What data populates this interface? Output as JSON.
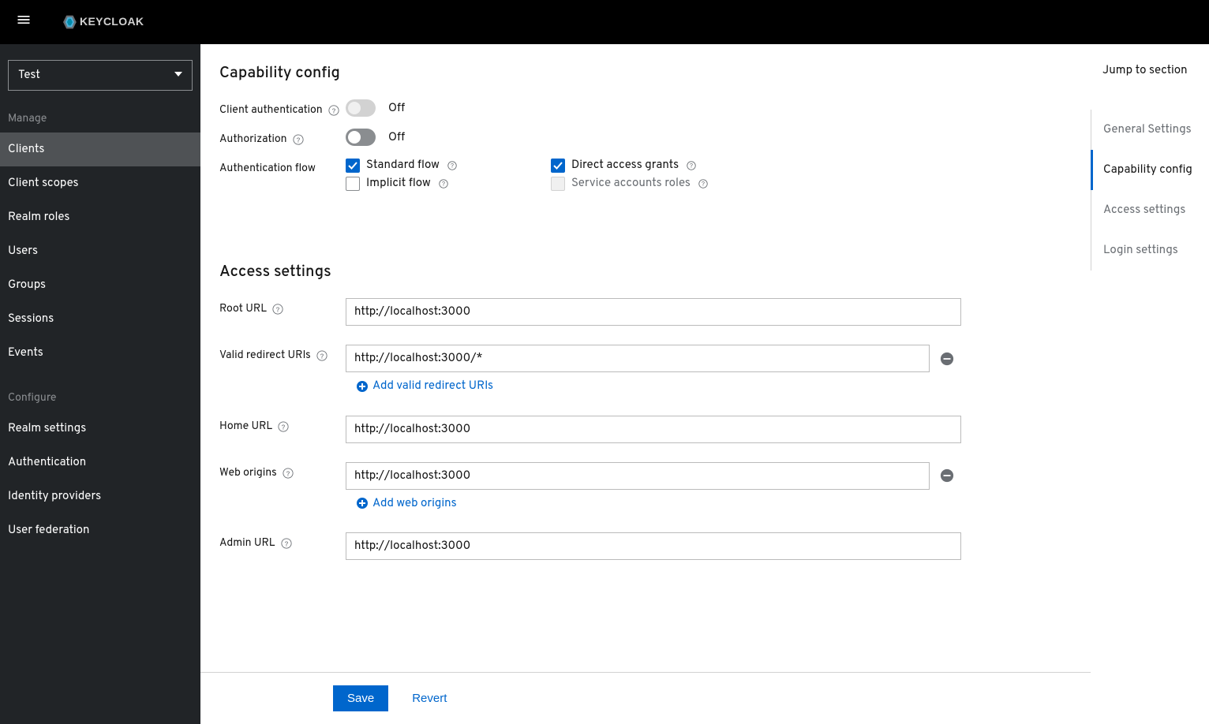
{
  "header": {
    "brand": "KEYCLOAK"
  },
  "sidebar": {
    "realm": "Test",
    "sections": [
      {
        "title": "Manage",
        "items": [
          "Clients",
          "Client scopes",
          "Realm roles",
          "Users",
          "Groups",
          "Sessions",
          "Events"
        ],
        "active_index": 0
      },
      {
        "title": "Configure",
        "items": [
          "Realm settings",
          "Authentication",
          "Identity providers",
          "User federation"
        ],
        "active_index": -1
      }
    ]
  },
  "capability": {
    "title": "Capability config",
    "client_auth_label": "Client authentication",
    "client_auth_value": "Off",
    "authorization_label": "Authorization",
    "authorization_value": "Off",
    "auth_flow_label": "Authentication flow",
    "flows": {
      "standard": {
        "label": "Standard flow",
        "checked": true
      },
      "direct": {
        "label": "Direct access grants",
        "checked": true
      },
      "implicit": {
        "label": "Implicit flow",
        "checked": false
      },
      "service": {
        "label": "Service accounts roles",
        "checked": false,
        "disabled": true
      }
    }
  },
  "access": {
    "title": "Access settings",
    "root_url_label": "Root URL",
    "root_url_value": "http://localhost:3000",
    "redirect_label": "Valid redirect URIs",
    "redirect_value": "http://localhost:3000/*",
    "redirect_add": "Add valid redirect URIs",
    "home_url_label": "Home URL",
    "home_url_value": "http://localhost:3000",
    "web_origins_label": "Web origins",
    "web_origins_value": "http://localhost:3000",
    "web_origins_add": "Add web origins",
    "admin_url_label": "Admin URL",
    "admin_url_value": "http://localhost:3000"
  },
  "footer": {
    "save": "Save",
    "revert": "Revert"
  },
  "jump": {
    "title": "Jump to section",
    "items": [
      "General Settings",
      "Capability config",
      "Access settings",
      "Login settings"
    ],
    "active_index": 1
  }
}
